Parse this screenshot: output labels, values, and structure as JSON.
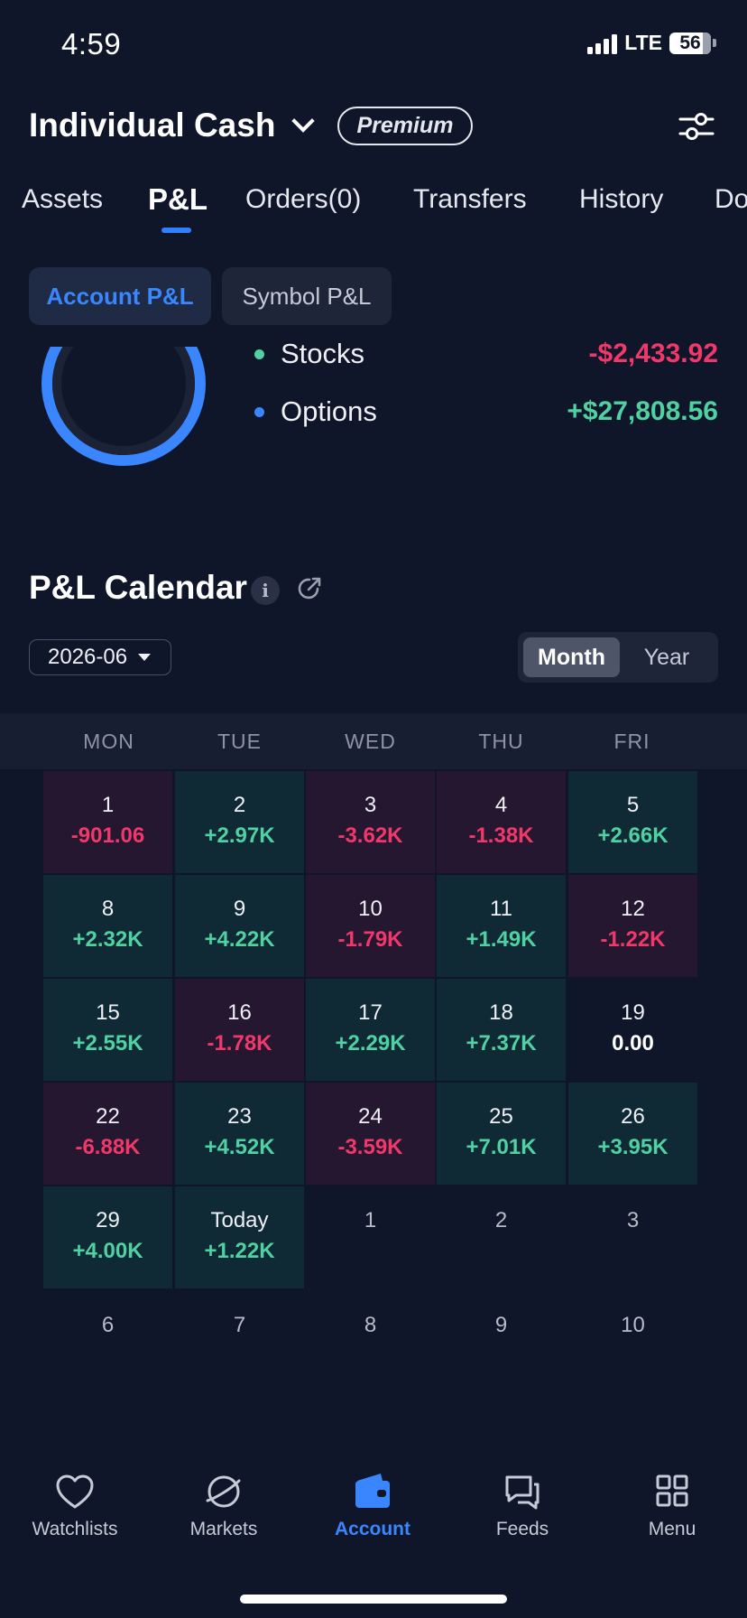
{
  "status": {
    "time": "4:59",
    "network": "LTE",
    "battery": "56"
  },
  "header": {
    "account_name": "Individual Cash",
    "badge": "Premium",
    "settings_icon": "sliders-icon"
  },
  "tabs": [
    {
      "label": "Assets"
    },
    {
      "label": "P&L"
    },
    {
      "label": "Orders(0)"
    },
    {
      "label": "Transfers"
    },
    {
      "label": "History"
    },
    {
      "label": "Do"
    }
  ],
  "pnl_switch": {
    "account": "Account P&L",
    "symbol": "Symbol P&L"
  },
  "breakdown": [
    {
      "label": "Stocks",
      "value": "-$2,433.92",
      "color": "#4fd1a1",
      "trend": "negative"
    },
    {
      "label": "Options",
      "value": "+$27,808.56",
      "color": "#3a86ff",
      "trend": "positive"
    }
  ],
  "calendar": {
    "title": "P&L Calendar",
    "info_icon": "i",
    "selected_month": "2026-06",
    "modes": {
      "month": "Month",
      "year": "Year"
    },
    "weekdays": [
      "MON",
      "TUE",
      "WED",
      "THU",
      "FRI"
    ],
    "weeks": [
      [
        {
          "day": "1",
          "value": "-901.06",
          "kind": "neg"
        },
        {
          "day": "2",
          "value": "+2.97K",
          "kind": "pos"
        },
        {
          "day": "3",
          "value": "-3.62K",
          "kind": "neg"
        },
        {
          "day": "4",
          "value": "-1.38K",
          "kind": "neg"
        },
        {
          "day": "5",
          "value": "+2.66K",
          "kind": "pos"
        }
      ],
      [
        {
          "day": "8",
          "value": "+2.32K",
          "kind": "pos"
        },
        {
          "day": "9",
          "value": "+4.22K",
          "kind": "pos"
        },
        {
          "day": "10",
          "value": "-1.79K",
          "kind": "neg"
        },
        {
          "day": "11",
          "value": "+1.49K",
          "kind": "pos"
        },
        {
          "day": "12",
          "value": "-1.22K",
          "kind": "neg"
        }
      ],
      [
        {
          "day": "15",
          "value": "+2.55K",
          "kind": "pos"
        },
        {
          "day": "16",
          "value": "-1.78K",
          "kind": "neg"
        },
        {
          "day": "17",
          "value": "+2.29K",
          "kind": "pos"
        },
        {
          "day": "18",
          "value": "+7.37K",
          "kind": "pos"
        },
        {
          "day": "19",
          "value": "0.00",
          "kind": "zero"
        }
      ],
      [
        {
          "day": "22",
          "value": "-6.88K",
          "kind": "neg"
        },
        {
          "day": "23",
          "value": "+4.52K",
          "kind": "pos"
        },
        {
          "day": "24",
          "value": "-3.59K",
          "kind": "neg"
        },
        {
          "day": "25",
          "value": "+7.01K",
          "kind": "pos"
        },
        {
          "day": "26",
          "value": "+3.95K",
          "kind": "pos"
        }
      ],
      [
        {
          "day": "29",
          "value": "+4.00K",
          "kind": "pos"
        },
        {
          "day": "Today",
          "value": "+1.22K",
          "kind": "pos"
        },
        {
          "day": "1",
          "value": "",
          "kind": "dim"
        },
        {
          "day": "2",
          "value": "",
          "kind": "dim"
        },
        {
          "day": "3",
          "value": "",
          "kind": "dim"
        }
      ],
      [
        {
          "day": "6",
          "value": "",
          "kind": "dim"
        },
        {
          "day": "7",
          "value": "",
          "kind": "dim"
        },
        {
          "day": "8",
          "value": "",
          "kind": "dim"
        },
        {
          "day": "9",
          "value": "",
          "kind": "dim"
        },
        {
          "day": "10",
          "value": "",
          "kind": "dim"
        }
      ]
    ]
  },
  "nav": [
    {
      "label": "Watchlists",
      "icon": "heart-icon"
    },
    {
      "label": "Markets",
      "icon": "planet-icon"
    },
    {
      "label": "Account",
      "icon": "wallet-icon",
      "active": true
    },
    {
      "label": "Feeds",
      "icon": "chat-icon"
    },
    {
      "label": "Menu",
      "icon": "grid-icon"
    }
  ],
  "colors": {
    "positive": "#4fd1a1",
    "negative": "#f0386b",
    "accent": "#3a86ff",
    "background": "#101629"
  }
}
